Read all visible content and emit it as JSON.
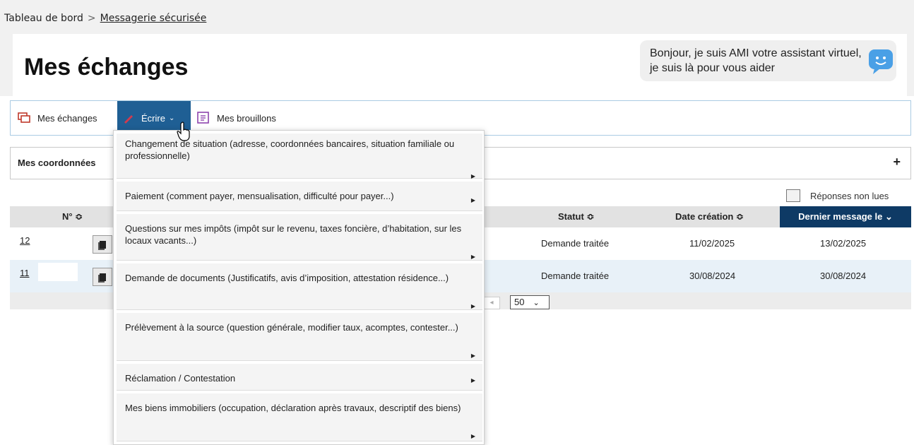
{
  "breadcrumb": {
    "home": "Tableau de bord",
    "separator": ">",
    "current": "Messagerie sécurisée"
  },
  "page": {
    "title": "Mes échanges"
  },
  "assistant": {
    "text": "Bonjour, je suis AMI votre assistant virtuel, je suis là pour vous aider",
    "icon": "chat-bot-icon",
    "accent": "#4aa0e6"
  },
  "toolbar": {
    "items": [
      {
        "label": "Mes échanges",
        "icon": "conversation-icon",
        "icon_color": "#c0392b"
      },
      {
        "label": "Écrire",
        "icon": "pencil-icon",
        "icon_color": "#d13a4e",
        "active": true
      },
      {
        "label": "Mes brouillons",
        "icon": "draft-icon",
        "icon_color": "#8e44ad"
      }
    ],
    "active_color": "#1f5f94"
  },
  "coordinates": {
    "label": "Mes coordonnées",
    "expand": "+"
  },
  "filter": {
    "unread_label": "Réponses non lues"
  },
  "table": {
    "headers": {
      "num": "N° ≎",
      "status": "Statut ≎",
      "created": "Date création ≎",
      "last": "Dernier message le ⌄"
    },
    "rows": [
      {
        "num": "12",
        "status": "Demande traitée",
        "created": "11/02/2025",
        "last": "13/02/2025"
      },
      {
        "num": "11",
        "status": "Demande traitée",
        "created": "30/08/2024",
        "last": "30/08/2024"
      }
    ],
    "header_active_color": "#0e3a65"
  },
  "pagination": {
    "page_size": "50",
    "prev_label": "◂"
  },
  "dropdown": {
    "items": [
      {
        "label": "Changement de situation (adresse, coordonnées bancaires, situation familiale ou professionnelle)"
      },
      {
        "label": "Paiement (comment payer, mensualisation, difficulté pour payer...)"
      },
      {
        "label": "Questions sur mes impôts (impôt sur le revenu, taxes foncière, d’habitation, sur les locaux vacants...)"
      },
      {
        "label": "Demande de documents (Justificatifs, avis d’imposition, attestation résidence...)"
      },
      {
        "label": "Prélèvement à la source (question générale, modifier taux, acomptes, contester...)"
      },
      {
        "label": "Réclamation / Contestation"
      },
      {
        "label": "Mes biens immobiliers (occupation, déclaration après travaux, descriptif des biens)"
      }
    ]
  }
}
